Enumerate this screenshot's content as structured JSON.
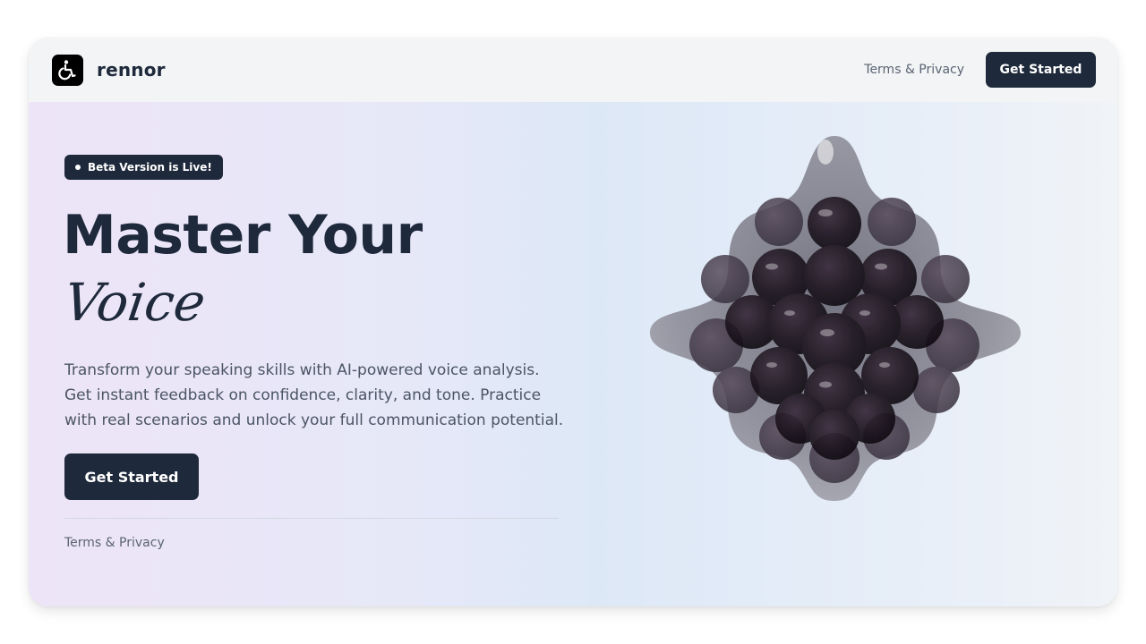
{
  "header": {
    "brand": "rennor",
    "logo_icon": "accessibility-icon",
    "nav_link": "Terms & Privacy",
    "cta_label": "Get Started"
  },
  "hero": {
    "badge": "Beta Version is Live!",
    "title_line1": "Master Your",
    "title_line2": "Voice",
    "description": "Transform your speaking skills with AI-powered voice analysis. Get instant feedback on confidence, clarity, and tone. Practice with real scenarios and unlock your full communication potential.",
    "cta_label": "Get Started",
    "footer_link": "Terms & Privacy"
  },
  "colors": {
    "primary": "#1e293b",
    "muted_text": "#4b5563",
    "header_bg": "#f2f4f6"
  }
}
